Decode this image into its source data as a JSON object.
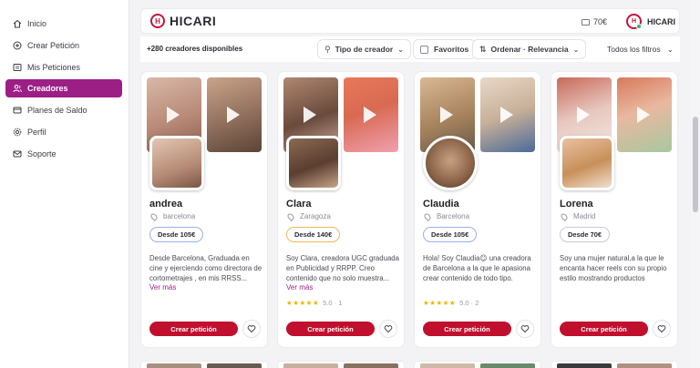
{
  "sidebar": {
    "items": [
      {
        "label": "Inicio",
        "icon": "home-icon"
      },
      {
        "label": "Crear Petición",
        "icon": "plus-circle-icon"
      },
      {
        "label": "Mis Peticiones",
        "icon": "list-icon"
      },
      {
        "label": "Creadores",
        "icon": "users-icon",
        "active": true
      },
      {
        "label": "Planes de Saldo",
        "icon": "credit-card-icon"
      },
      {
        "label": "Perfil",
        "icon": "gear-icon"
      },
      {
        "label": "Soporte",
        "icon": "mail-icon"
      }
    ]
  },
  "header": {
    "logo_text": "HICARI",
    "logo_mark": "H",
    "balance": "70€",
    "user_name": "HICARI",
    "user_initial": "H"
  },
  "filters": {
    "count_label": "+280 creadores disponibles",
    "creator_type": "Tipo de creador",
    "favorites": "Favoritos",
    "sort": "Ordenar · Relevancia",
    "all_filters": "Todos los filtros"
  },
  "creators": [
    {
      "name": "andrea",
      "location": "barcelona",
      "price": "Desde 105€",
      "description": "Desde Barcelona, Graduada en cine y ejerciendo como directora de cortometrajes , en mis RRSS...",
      "more": "Ver más",
      "rating": "",
      "stars": "",
      "cta": "Crear petición",
      "price_border": "#9ab0e6"
    },
    {
      "name": "Clara",
      "location": "Zaragoza",
      "price": "Desde 140€",
      "description": "Soy Clara, creadora UGC graduada en Publicidad y RRPP. Creo contenido que no solo muestra...",
      "more": "Ver más",
      "rating": "5.0 · 1",
      "stars": "★★★★★",
      "cta": "Crear petición",
      "price_border": "#f0b75a"
    },
    {
      "name": "Claudia",
      "location": "Barcelona",
      "price": "Desde 105€",
      "description": "Hola! Soy Claudia😊 una creadora de Barcelona a la que le apasiona crear contenido de todo tipo.",
      "more": "",
      "rating": "5.0 · 2",
      "stars": "★★★★★",
      "cta": "Crear petición",
      "price_border": "#9ab0e6"
    },
    {
      "name": "Lorena",
      "location": "Madrid",
      "price": "Desde 70€",
      "description": "Soy una mujer natural,a la que le encanta hacer reels con su propio estilo mostrando productos",
      "more": "",
      "rating": "",
      "stars": "",
      "cta": "Crear petición",
      "price_border": "#c9c9d2"
    }
  ],
  "colors": {
    "accent": "#9c1f86",
    "cta": "#c10f2e",
    "brand": "#c0183c"
  }
}
